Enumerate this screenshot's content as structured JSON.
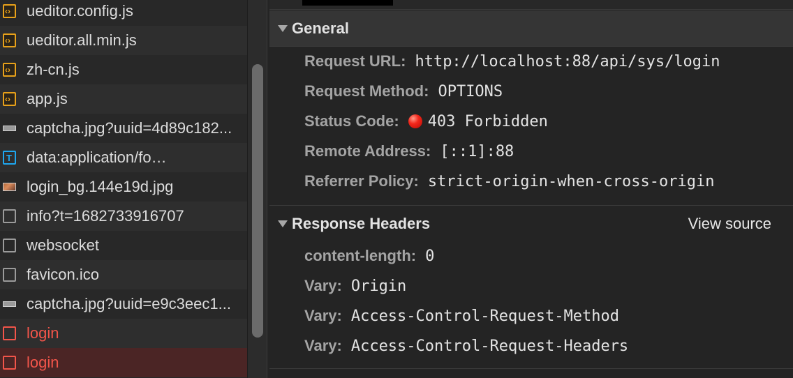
{
  "requests": [
    {
      "name": "ueditor.config.js",
      "icon": "js-file-icon",
      "type": "js"
    },
    {
      "name": "ueditor.all.min.js",
      "icon": "js-file-icon",
      "type": "js"
    },
    {
      "name": "zh-cn.js",
      "icon": "js-file-icon",
      "type": "js"
    },
    {
      "name": "app.js",
      "icon": "js-file-icon",
      "type": "js"
    },
    {
      "name": "captcha.jpg?uuid=4d89c182...",
      "icon": "image-file-icon",
      "type": "img"
    },
    {
      "name": "data:application/fo…",
      "icon": "font-file-icon",
      "type": "font"
    },
    {
      "name": "login_bg.144e19d.jpg",
      "icon": "image-thumbnail-icon",
      "type": "imgcolor"
    },
    {
      "name": "info?t=1682733916707",
      "icon": "document-icon",
      "type": "doc"
    },
    {
      "name": "websocket",
      "icon": "document-icon",
      "type": "doc"
    },
    {
      "name": "favicon.ico",
      "icon": "document-icon",
      "type": "doc"
    },
    {
      "name": "captcha.jpg?uuid=e9c3eec1...",
      "icon": "image-file-icon",
      "type": "img"
    },
    {
      "name": "login",
      "icon": "error-document-icon",
      "type": "err"
    },
    {
      "name": "login",
      "icon": "error-document-icon",
      "type": "err"
    }
  ],
  "general": {
    "title": "General",
    "request_url_label": "Request URL:",
    "request_url": "http://localhost:88/api/sys/login",
    "request_method_label": "Request Method:",
    "request_method": "OPTIONS",
    "status_code_label": "Status Code:",
    "status_code": "403 Forbidden",
    "remote_address_label": "Remote Address:",
    "remote_address": "[::1]:88",
    "referrer_policy_label": "Referrer Policy:",
    "referrer_policy": "strict-origin-when-cross-origin"
  },
  "response_headers": {
    "title": "Response Headers",
    "view_source": "View source",
    "headers": [
      {
        "key": "content-length:",
        "value": "0"
      },
      {
        "key": "Vary:",
        "value": "Origin"
      },
      {
        "key": "Vary:",
        "value": "Access-Control-Request-Method"
      },
      {
        "key": "Vary:",
        "value": "Access-Control-Request-Headers"
      }
    ]
  },
  "colors": {
    "error_text": "#f2554a",
    "selected_row": "#4b2525",
    "js_icon": "#e8a11a",
    "font_icon": "#1ea7f0",
    "status_red": "#f2261a"
  }
}
